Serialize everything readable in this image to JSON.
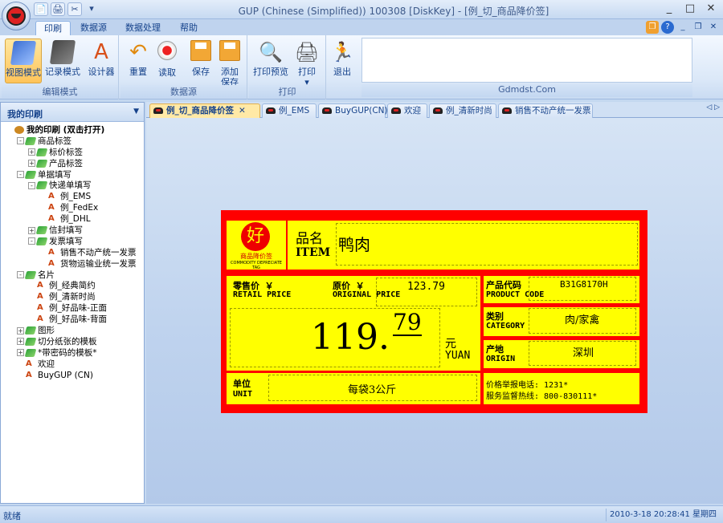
{
  "window": {
    "title": "GUP (Chinese (Simplified)) 100308 [DiskKey] - [例_切_商品降价签]",
    "buttons": [
      "_",
      "□",
      "✕"
    ],
    "mdi_buttons": [
      "❐",
      "?",
      "_",
      "❐",
      "✕"
    ]
  },
  "qat": {
    "icons": [
      "📄",
      "🖨",
      "✂",
      "▾"
    ]
  },
  "ribbon_tabs": [
    {
      "label": "印刷",
      "active": true
    },
    {
      "label": "数据源"
    },
    {
      "label": "数据处理"
    },
    {
      "label": "帮助"
    }
  ],
  "ribbon": {
    "groups": [
      {
        "label": "编辑模式",
        "buttons": [
          "视图模式",
          "记录模式",
          "设计器"
        ]
      },
      {
        "label": "数据源",
        "buttons": [
          "重置",
          "读取",
          "保存",
          "添加\n保存"
        ]
      },
      {
        "label": "打印",
        "buttons": [
          "打印预览",
          "打印\n▾"
        ]
      },
      {
        "label": "",
        "buttons": [
          "退出"
        ]
      }
    ],
    "site": "Gdmdst.Com"
  },
  "sidebar": {
    "title": "我的印刷",
    "tree": [
      {
        "level": 0,
        "toggle": "",
        "icon": "root",
        "label": "我的印刷 (双击打开)",
        "bold": true
      },
      {
        "level": 1,
        "toggle": "-",
        "icon": "green",
        "label": "商品标签"
      },
      {
        "level": 2,
        "toggle": "+",
        "icon": "green",
        "label": "标价标签"
      },
      {
        "level": 2,
        "toggle": "+",
        "icon": "green",
        "label": "产品标签"
      },
      {
        "level": 1,
        "toggle": "-",
        "icon": "green",
        "label": "单据填写"
      },
      {
        "level": 2,
        "toggle": "-",
        "icon": "green",
        "label": "快递单填写"
      },
      {
        "level": 3,
        "toggle": "",
        "icon": "lbl",
        "label": "例_EMS"
      },
      {
        "level": 3,
        "toggle": "",
        "icon": "lbl",
        "label": "例_FedEx"
      },
      {
        "level": 3,
        "toggle": "",
        "icon": "lbl",
        "label": "例_DHL"
      },
      {
        "level": 2,
        "toggle": "+",
        "icon": "green",
        "label": "信封填写"
      },
      {
        "level": 2,
        "toggle": "-",
        "icon": "green",
        "label": "发票填写"
      },
      {
        "level": 3,
        "toggle": "",
        "icon": "lbl",
        "label": "销售不动产统一发票"
      },
      {
        "level": 3,
        "toggle": "",
        "icon": "lbl",
        "label": "货物运输业统一发票"
      },
      {
        "level": 1,
        "toggle": "-",
        "icon": "green",
        "label": "名片"
      },
      {
        "level": 2,
        "toggle": "",
        "icon": "lbl",
        "label": "例_经典简约"
      },
      {
        "level": 2,
        "toggle": "",
        "icon": "lbl",
        "label": "例_清新时尚"
      },
      {
        "level": 2,
        "toggle": "",
        "icon": "lbl",
        "label": "例_好品味-正面"
      },
      {
        "level": 2,
        "toggle": "",
        "icon": "lbl",
        "label": "例_好品味-背面"
      },
      {
        "level": 1,
        "toggle": "+",
        "icon": "green",
        "label": "图形"
      },
      {
        "level": 1,
        "toggle": "+",
        "icon": "green",
        "label": "切分纸张的模板"
      },
      {
        "level": 1,
        "toggle": "+",
        "icon": "green",
        "label": "*带密码的模板*"
      },
      {
        "level": 1,
        "toggle": "",
        "icon": "lbl",
        "label": "欢迎"
      },
      {
        "level": 1,
        "toggle": "",
        "icon": "lbl",
        "label": "BuyGUP (CN)"
      }
    ]
  },
  "doc_tabs": [
    {
      "label": "例_切_商品降价签",
      "active": true,
      "close": "✕"
    },
    {
      "label": "例_EMS"
    },
    {
      "label": "BuyGUP(CN)"
    },
    {
      "label": "欢迎"
    },
    {
      "label": "例_清新时尚"
    },
    {
      "label": "销售不动产统一发票"
    }
  ],
  "doc_nav": "◁ ▷",
  "price_tag": {
    "logo_char": "好",
    "logo_caption": "商品降价签",
    "logo_sub": "COMMODITY DEPRECIATE TAG",
    "item_label_cn": "品名",
    "item_label_en": "ITEM",
    "item_value": "鸭肉",
    "retail_label_cn": "零售价 ￥",
    "retail_label_en": "RETAIL PRICE",
    "original_label_cn": "原价 ￥",
    "original_label_en": "ORIGINAL PRICE",
    "original_value": "123.79",
    "price_main": "119.",
    "price_cents": "79",
    "currency_cn": "元",
    "currency_en": "YUAN",
    "code_label_cn": "产品代码",
    "code_label_en": "PRODUCT CODE",
    "code_value": "B31G8170H",
    "category_label_cn": "类别",
    "category_label_en": "CATEGORY",
    "category_value": "肉/家禽",
    "origin_label_cn": "产地",
    "origin_label_en": "ORIGIN",
    "origin_value": "深圳",
    "unit_label_cn": "单位",
    "unit_label_en": "UNIT",
    "unit_value": "每袋3公斤",
    "phone_line": "价格举报电话: 1231*",
    "hotline_line": "服务监督热线: 800-830111*"
  },
  "status": {
    "left": "就绪",
    "datetime": "2010-3-18 20:28:41 星期四"
  }
}
